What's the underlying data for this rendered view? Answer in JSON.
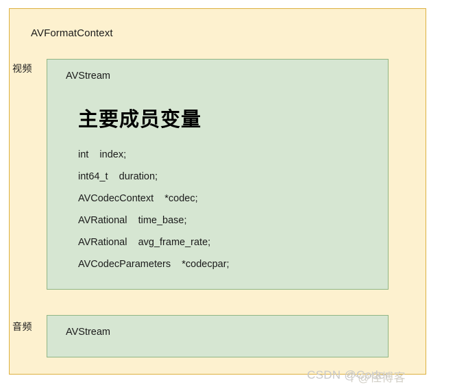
{
  "diagram": {
    "title": "AVFormatContext",
    "side_labels": {
      "video": "视频",
      "audio": "音频"
    },
    "video_stream": {
      "title": "AVStream",
      "members_heading": "主要成员变量",
      "members": [
        "int    index;",
        "int64_t    duration;",
        "AVCodecContext    *codec;",
        "AVRational    time_base;",
        "AVRational    avg_frame_rate;",
        "AVCodecParameters    *codecpar;"
      ]
    },
    "audio_stream": {
      "title": "AVStream"
    }
  },
  "watermark": {
    "primary": "CSDN @Coder",
    "secondary": "个@怪博客"
  },
  "colors": {
    "page_background": "#ffffff",
    "context_fill": "#fdf1cf",
    "context_border": "#dcb03f",
    "stream_fill": "#d6e6d2",
    "stream_border": "#8fb584",
    "text": "#1a1a1a",
    "heading": "#000000",
    "watermark": "#c9c9c9"
  }
}
